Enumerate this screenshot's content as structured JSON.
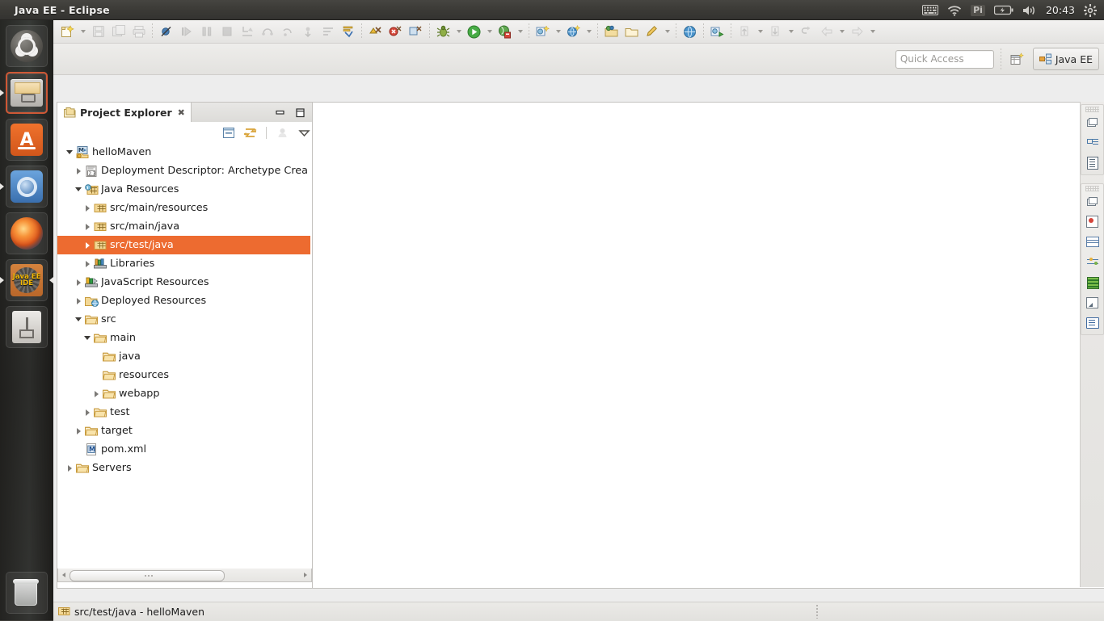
{
  "desktop": {
    "top_panel": {
      "window_title": "Java EE - Eclipse",
      "clock": "20:43",
      "indicators": [
        {
          "name": "keyboard-indicator",
          "label": "⌨"
        },
        {
          "name": "wifi-indicator",
          "label": "◠"
        },
        {
          "name": "pi-indicator",
          "label": "Pi"
        },
        {
          "name": "battery-indicator",
          "label": "▭"
        },
        {
          "name": "volume-indicator",
          "label": "◂))"
        }
      ],
      "session_menu": "gear-icon"
    },
    "launcher": {
      "items": [
        {
          "name": "ubuntu-dash",
          "label": "Ubuntu Dash",
          "running": false,
          "selected": false
        },
        {
          "name": "files",
          "label": "Files",
          "running": true,
          "selected": true
        },
        {
          "name": "ubuntu-software",
          "label": "Ubuntu Software Center",
          "running": false,
          "selected": false
        },
        {
          "name": "chromium",
          "label": "Chromium Web Browser",
          "running": true,
          "selected": false
        },
        {
          "name": "firefox",
          "label": "Firefox Web Browser",
          "running": false,
          "selected": false
        },
        {
          "name": "eclipse",
          "label": "Java EE IDE",
          "running": true,
          "selected": false,
          "badge": "Java EE\nIDE"
        },
        {
          "name": "usb-drive",
          "label": "USB Drive",
          "running": false,
          "selected": false
        }
      ],
      "trash": {
        "name": "trash",
        "label": "Trash"
      }
    }
  },
  "toolbar": {
    "row1_groups": [
      {
        "name": "file-group",
        "buttons": [
          {
            "name": "new-wizard-button",
            "icon": "new-file-icon",
            "enabled": true,
            "dropdown": true
          },
          {
            "name": "save-button",
            "icon": "save-icon",
            "enabled": false
          },
          {
            "name": "save-all-button",
            "icon": "save-all-icon",
            "enabled": false
          },
          {
            "name": "print-button",
            "icon": "print-icon",
            "enabled": false
          }
        ]
      },
      {
        "name": "edit-group",
        "buttons": [
          {
            "name": "toggle-breakpoint-button",
            "icon": "breakpoint-disabled-icon",
            "enabled": true
          },
          {
            "name": "resume-button",
            "icon": "resume-icon",
            "enabled": false
          },
          {
            "name": "suspend-button",
            "icon": "suspend-icon",
            "enabled": false
          },
          {
            "name": "terminate-button",
            "icon": "terminate-icon",
            "enabled": false
          },
          {
            "name": "step-into-button",
            "icon": "step-into-icon",
            "enabled": false
          },
          {
            "name": "step-over-button",
            "icon": "step-over-icon",
            "enabled": false
          },
          {
            "name": "step-return-button",
            "icon": "step-return-icon",
            "enabled": false
          },
          {
            "name": "drop-to-frame-button",
            "icon": "drop-to-frame-icon",
            "enabled": false
          },
          {
            "name": "use-step-filters-button",
            "icon": "step-filters-icon",
            "enabled": false
          },
          {
            "name": "annotation-button",
            "icon": "annotation-icon",
            "enabled": true
          }
        ]
      },
      {
        "name": "marker-group",
        "buttons": [
          {
            "name": "next-annotation-button",
            "icon": "next-annotation-icon",
            "enabled": true
          },
          {
            "name": "previous-annotation-button",
            "icon": "previous-annotation-icon",
            "enabled": true
          },
          {
            "name": "last-edit-location-button",
            "icon": "last-edit-icon",
            "enabled": true
          }
        ]
      },
      {
        "name": "debug-run-group",
        "buttons": [
          {
            "name": "debug-button",
            "icon": "debug-bug-icon",
            "enabled": true,
            "dropdown": true
          },
          {
            "name": "run-button",
            "icon": "run-play-icon",
            "enabled": true,
            "dropdown": true
          },
          {
            "name": "run-server-button",
            "icon": "run-server-icon",
            "enabled": true,
            "dropdown": true
          }
        ]
      },
      {
        "name": "new-group",
        "buttons": [
          {
            "name": "new-java-ee-project-button",
            "icon": "new-project-icon",
            "enabled": true,
            "dropdown": true
          },
          {
            "name": "new-dynamic-web-project-button",
            "icon": "new-web-project-icon",
            "enabled": true,
            "dropdown": true
          }
        ]
      },
      {
        "name": "search-group",
        "buttons": [
          {
            "name": "open-type-button",
            "icon": "open-type-icon",
            "enabled": true
          },
          {
            "name": "open-task-button",
            "icon": "open-task-icon",
            "enabled": true
          },
          {
            "name": "search-button",
            "icon": "search-pencil-icon",
            "enabled": true,
            "dropdown": true
          }
        ]
      },
      {
        "name": "web-group",
        "buttons": [
          {
            "name": "open-web-browser-button",
            "icon": "globe-icon",
            "enabled": true
          }
        ]
      },
      {
        "name": "profile-group",
        "buttons": [
          {
            "name": "profile-button",
            "icon": "profile-icon",
            "enabled": true
          }
        ]
      },
      {
        "name": "navigate-group",
        "buttons": [
          {
            "name": "previous-edit-button",
            "icon": "previous-edit-icon",
            "enabled": false,
            "dropdown": true
          },
          {
            "name": "next-edit-button",
            "icon": "next-edit-icon",
            "enabled": false,
            "dropdown": true
          },
          {
            "name": "back-history-button",
            "icon": "back-arrow-icon",
            "enabled": false
          },
          {
            "name": "backward-button",
            "icon": "backward-icon",
            "enabled": false,
            "dropdown": true
          },
          {
            "name": "forward-button",
            "icon": "forward-icon",
            "enabled": false,
            "dropdown": true
          }
        ]
      }
    ],
    "quick_access": {
      "placeholder": "Quick Access",
      "value": ""
    },
    "open_perspective_button": "open-perspective-icon",
    "perspective": {
      "label": "Java EE",
      "active": true
    }
  },
  "explorer": {
    "tab_label": "Project Explorer",
    "close_glyph": "✖",
    "view_buttons": [
      {
        "name": "minimize-view-button",
        "icon": "minimize-icon"
      },
      {
        "name": "maximize-view-button",
        "icon": "maximize-icon"
      }
    ],
    "toolbar_buttons": [
      {
        "name": "collapse-all-button",
        "icon": "collapse-all-icon",
        "enabled": true
      },
      {
        "name": "link-with-editor-button",
        "icon": "link-editor-icon",
        "enabled": true
      },
      {
        "name": "focus-on-active-task-button",
        "icon": "focus-task-icon",
        "enabled": false
      },
      {
        "name": "view-menu-button",
        "icon": "view-menu-chevron-icon",
        "enabled": true
      }
    ],
    "tree": [
      {
        "label": "helloMaven",
        "depth": 0,
        "twisty": "open",
        "icon": "maven-project-icon",
        "selected": false
      },
      {
        "label": "Deployment Descriptor: Archetype Crea",
        "depth": 1,
        "twisty": "closed",
        "icon": "deployment-descriptor-icon",
        "selected": false
      },
      {
        "label": "Java Resources",
        "depth": 1,
        "twisty": "open",
        "icon": "java-resources-icon",
        "selected": false
      },
      {
        "label": "src/main/resources",
        "depth": 2,
        "twisty": "closed",
        "icon": "package-folder-icon",
        "selected": false
      },
      {
        "label": "src/main/java",
        "depth": 2,
        "twisty": "closed",
        "icon": "package-folder-icon",
        "selected": false
      },
      {
        "label": "src/test/java",
        "depth": 2,
        "twisty": "closed",
        "icon": "package-folder-icon",
        "selected": true
      },
      {
        "label": "Libraries",
        "depth": 2,
        "twisty": "closed",
        "icon": "libraries-icon",
        "selected": false
      },
      {
        "label": "JavaScript Resources",
        "depth": 1,
        "twisty": "closed",
        "icon": "javascript-resources-icon",
        "selected": false
      },
      {
        "label": "Deployed Resources",
        "depth": 1,
        "twisty": "closed",
        "icon": "deployed-resources-icon",
        "selected": false
      },
      {
        "label": "src",
        "depth": 1,
        "twisty": "open",
        "icon": "folder-icon",
        "selected": false
      },
      {
        "label": "main",
        "depth": 2,
        "twisty": "open",
        "icon": "folder-icon",
        "selected": false
      },
      {
        "label": "java",
        "depth": 3,
        "twisty": "none",
        "icon": "folder-icon",
        "selected": false
      },
      {
        "label": "resources",
        "depth": 3,
        "twisty": "none",
        "icon": "folder-icon",
        "selected": false
      },
      {
        "label": "webapp",
        "depth": 3,
        "twisty": "closed",
        "icon": "folder-icon",
        "selected": false
      },
      {
        "label": "test",
        "depth": 2,
        "twisty": "closed",
        "icon": "folder-icon",
        "selected": false
      },
      {
        "label": "target",
        "depth": 1,
        "twisty": "closed",
        "icon": "folder-icon",
        "selected": false
      },
      {
        "label": "pom.xml",
        "depth": 1,
        "twisty": "none",
        "icon": "pom-xml-icon",
        "selected": false
      },
      {
        "label": "Servers",
        "depth": 0,
        "twisty": "closed",
        "icon": "folder-icon",
        "selected": false
      }
    ],
    "scrollbar": {
      "name": "horizontal-scrollbar",
      "left_arrow": "◀",
      "right_arrow": "▶"
    }
  },
  "editor": {
    "empty": true,
    "view_buttons": [
      {
        "name": "minimize-editor-button",
        "icon": "minimize-icon"
      },
      {
        "name": "maximize-editor-button",
        "icon": "maximize-icon"
      }
    ]
  },
  "fastview": {
    "groups": [
      {
        "name": "outline-group",
        "items": [
          {
            "name": "restore-view-button",
            "icon": "restore-icon"
          },
          {
            "name": "outline-view-button",
            "icon": "outline-icon"
          },
          {
            "name": "task-list-view-button",
            "icon": "task-list-icon"
          }
        ]
      },
      {
        "name": "bottom-views-group",
        "items": [
          {
            "name": "restore-bottom-button",
            "icon": "restore-icon"
          },
          {
            "name": "servers-view-button",
            "icon": "servers-icon"
          },
          {
            "name": "data-source-explorer-button",
            "icon": "table-icon"
          },
          {
            "name": "properties-view-button",
            "icon": "properties-icon"
          },
          {
            "name": "snippets-view-button",
            "icon": "palette-icon"
          },
          {
            "name": "markers-view-button",
            "icon": "markers-icon"
          },
          {
            "name": "console-view-button",
            "icon": "console-icon"
          }
        ]
      }
    ]
  },
  "statusbar": {
    "selection_text": "src/test/java - helloMaven",
    "selection_icon": "package-folder-icon"
  }
}
